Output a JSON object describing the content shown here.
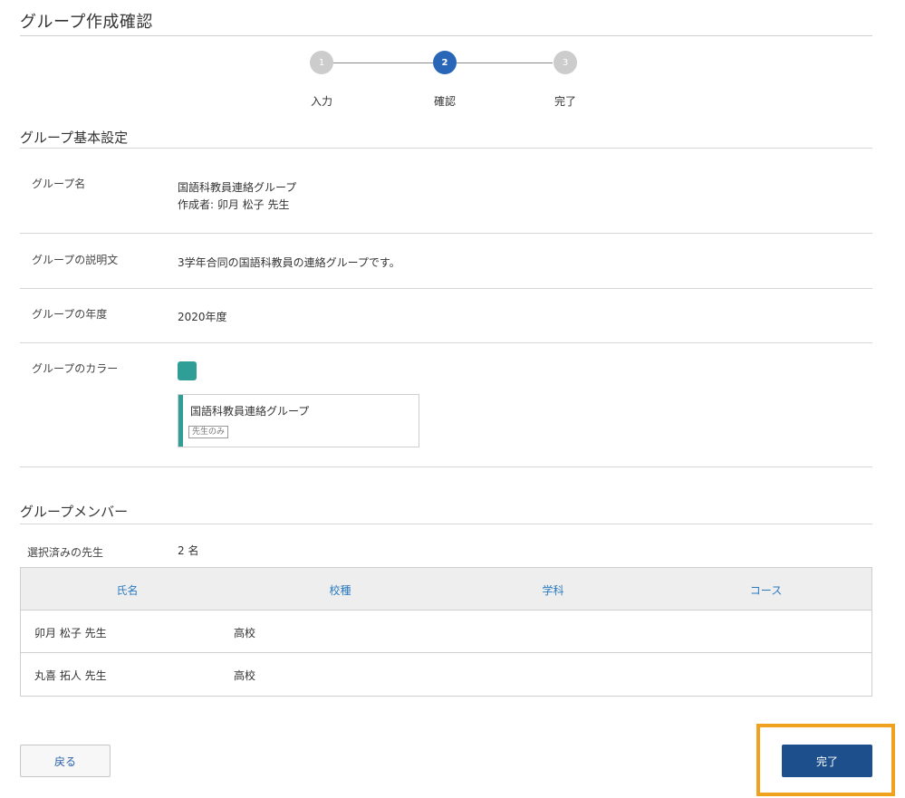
{
  "page": {
    "title": "グループ作成確認"
  },
  "stepper": {
    "steps": [
      {
        "number": "1",
        "label": "入力",
        "state": "inactive"
      },
      {
        "number": "2",
        "label": "確認",
        "state": "active"
      },
      {
        "number": "3",
        "label": "完了",
        "state": "inactive"
      }
    ]
  },
  "basic": {
    "title": "グループ基本設定",
    "name_label": "グループ名",
    "name_value": "国語科教員連絡グループ",
    "creator": "作成者: 卯月 松子 先生",
    "desc_label": "グループの説明文",
    "desc_value": "3学年合同の国語科教員の連絡グループです。",
    "year_label": "グループの年度",
    "year_value": "2020年度",
    "color_label": "グループのカラー",
    "color_hex": "#2e9e96",
    "preview_name": "国語科教員連絡グループ",
    "preview_badge": "先生のみ"
  },
  "members": {
    "title": "グループメンバー",
    "selected_label": "選択済みの先生",
    "selected_count": "2 名",
    "columns": [
      "氏名",
      "校種",
      "学科",
      "コース"
    ],
    "rows": [
      {
        "name": "卯月 松子 先生",
        "school": "高校",
        "dept": "",
        "course": ""
      },
      {
        "name": "丸喜 拓人 先生",
        "school": "高校",
        "dept": "",
        "course": ""
      }
    ]
  },
  "buttons": {
    "back": "戻る",
    "complete": "完了"
  },
  "colors": {
    "accent": "#1d4f8c",
    "active_step": "#2a66b8",
    "highlight": "#f0a21e"
  }
}
